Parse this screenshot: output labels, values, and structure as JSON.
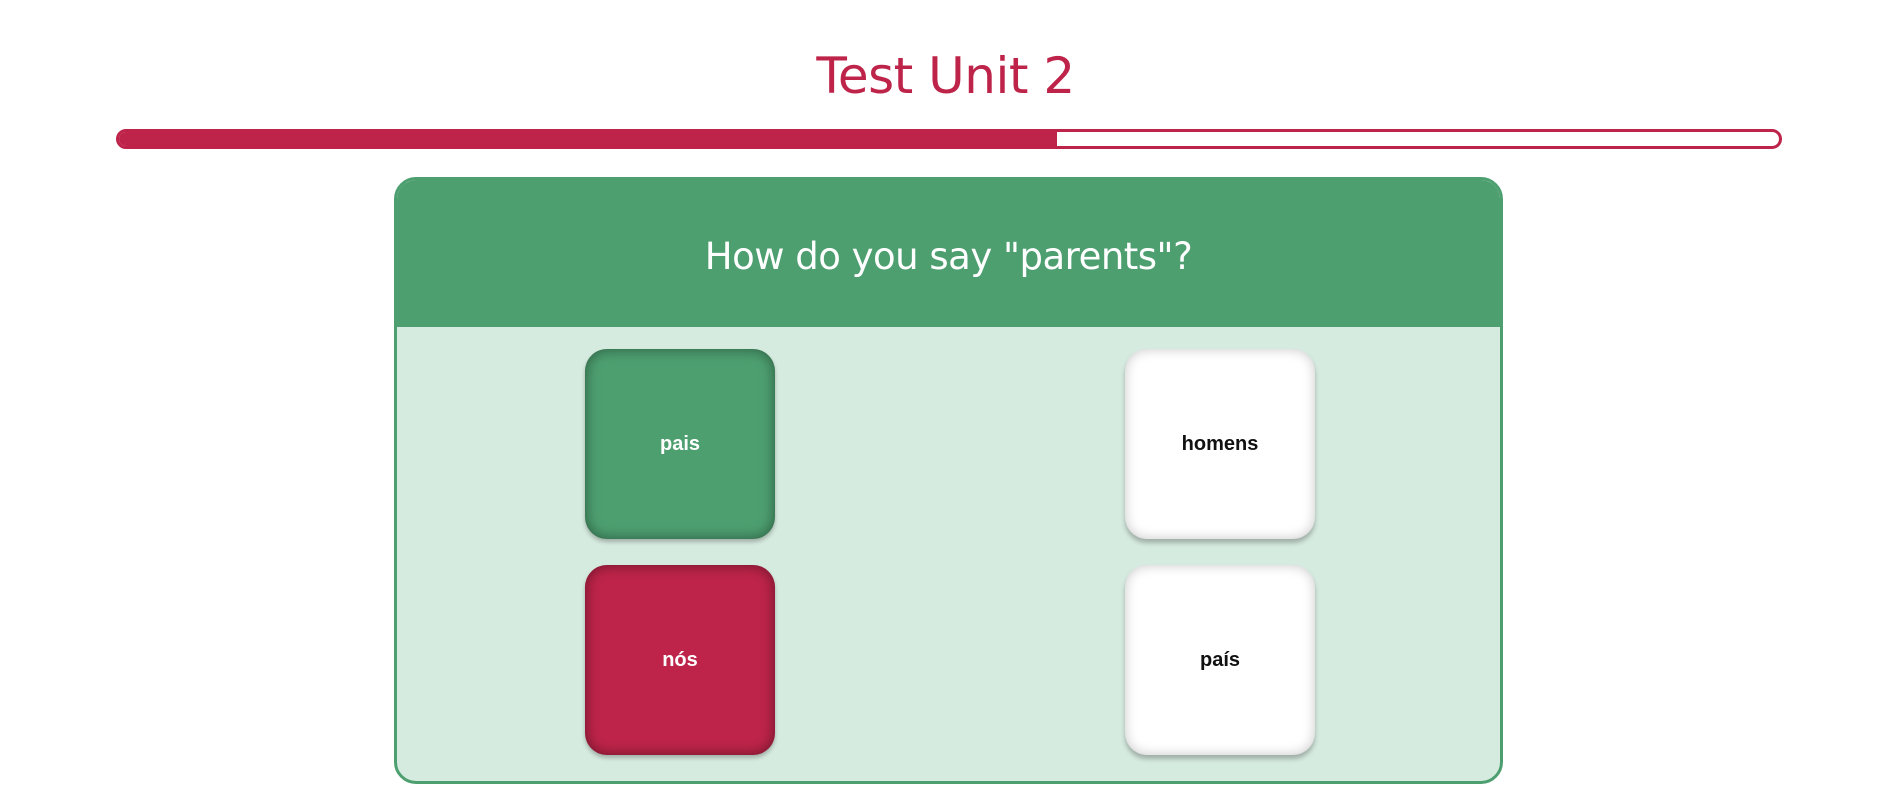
{
  "title": "Test Unit 2",
  "progress": {
    "fraction": 0.565
  },
  "question": {
    "text": "How do you say \"parents\"?"
  },
  "answers": [
    {
      "label": "pais",
      "state": "correct"
    },
    {
      "label": "homens",
      "state": "neutral"
    },
    {
      "label": "nós",
      "state": "incorrect"
    },
    {
      "label": "país",
      "state": "neutral"
    }
  ],
  "colors": {
    "brand_red": "#be2449",
    "brand_green": "#4d9f70",
    "card_body": "#d6ebe0",
    "tile_white": "#ffffff",
    "tile_text_dark": "#111111",
    "tile_text_light": "#ffffff"
  }
}
